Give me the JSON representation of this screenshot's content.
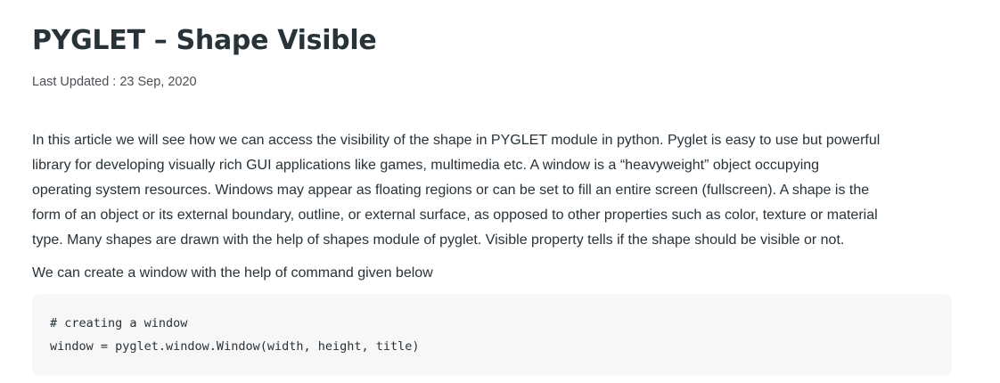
{
  "article": {
    "title": "PYGLET – Shape Visible",
    "last_updated": "Last Updated : 23 Sep, 2020",
    "intro_lines": [
      "In this article we will see how we can access the visibility of the shape in PYGLET module in python. Pyglet is easy to use but powerful",
      "library for developing visually rich GUI applications like games, multimedia etc. A window is a “heavyweight” object occupying",
      "operating system resources. Windows may appear as floating regions or can be set to fill an entire screen (fullscreen). A shape is the",
      "form of an object or its external boundary, outline, or external surface, as opposed to other properties such as color, texture or material",
      "type. Many shapes are drawn with the help of shapes module of pyglet. Visible property tells if the shape should be visible or not."
    ],
    "window_sentence": "We can create a window with the help of command given below",
    "code_lines": [
      "# creating a window",
      "window = pyglet.window.Window(width, height, title)"
    ]
  }
}
